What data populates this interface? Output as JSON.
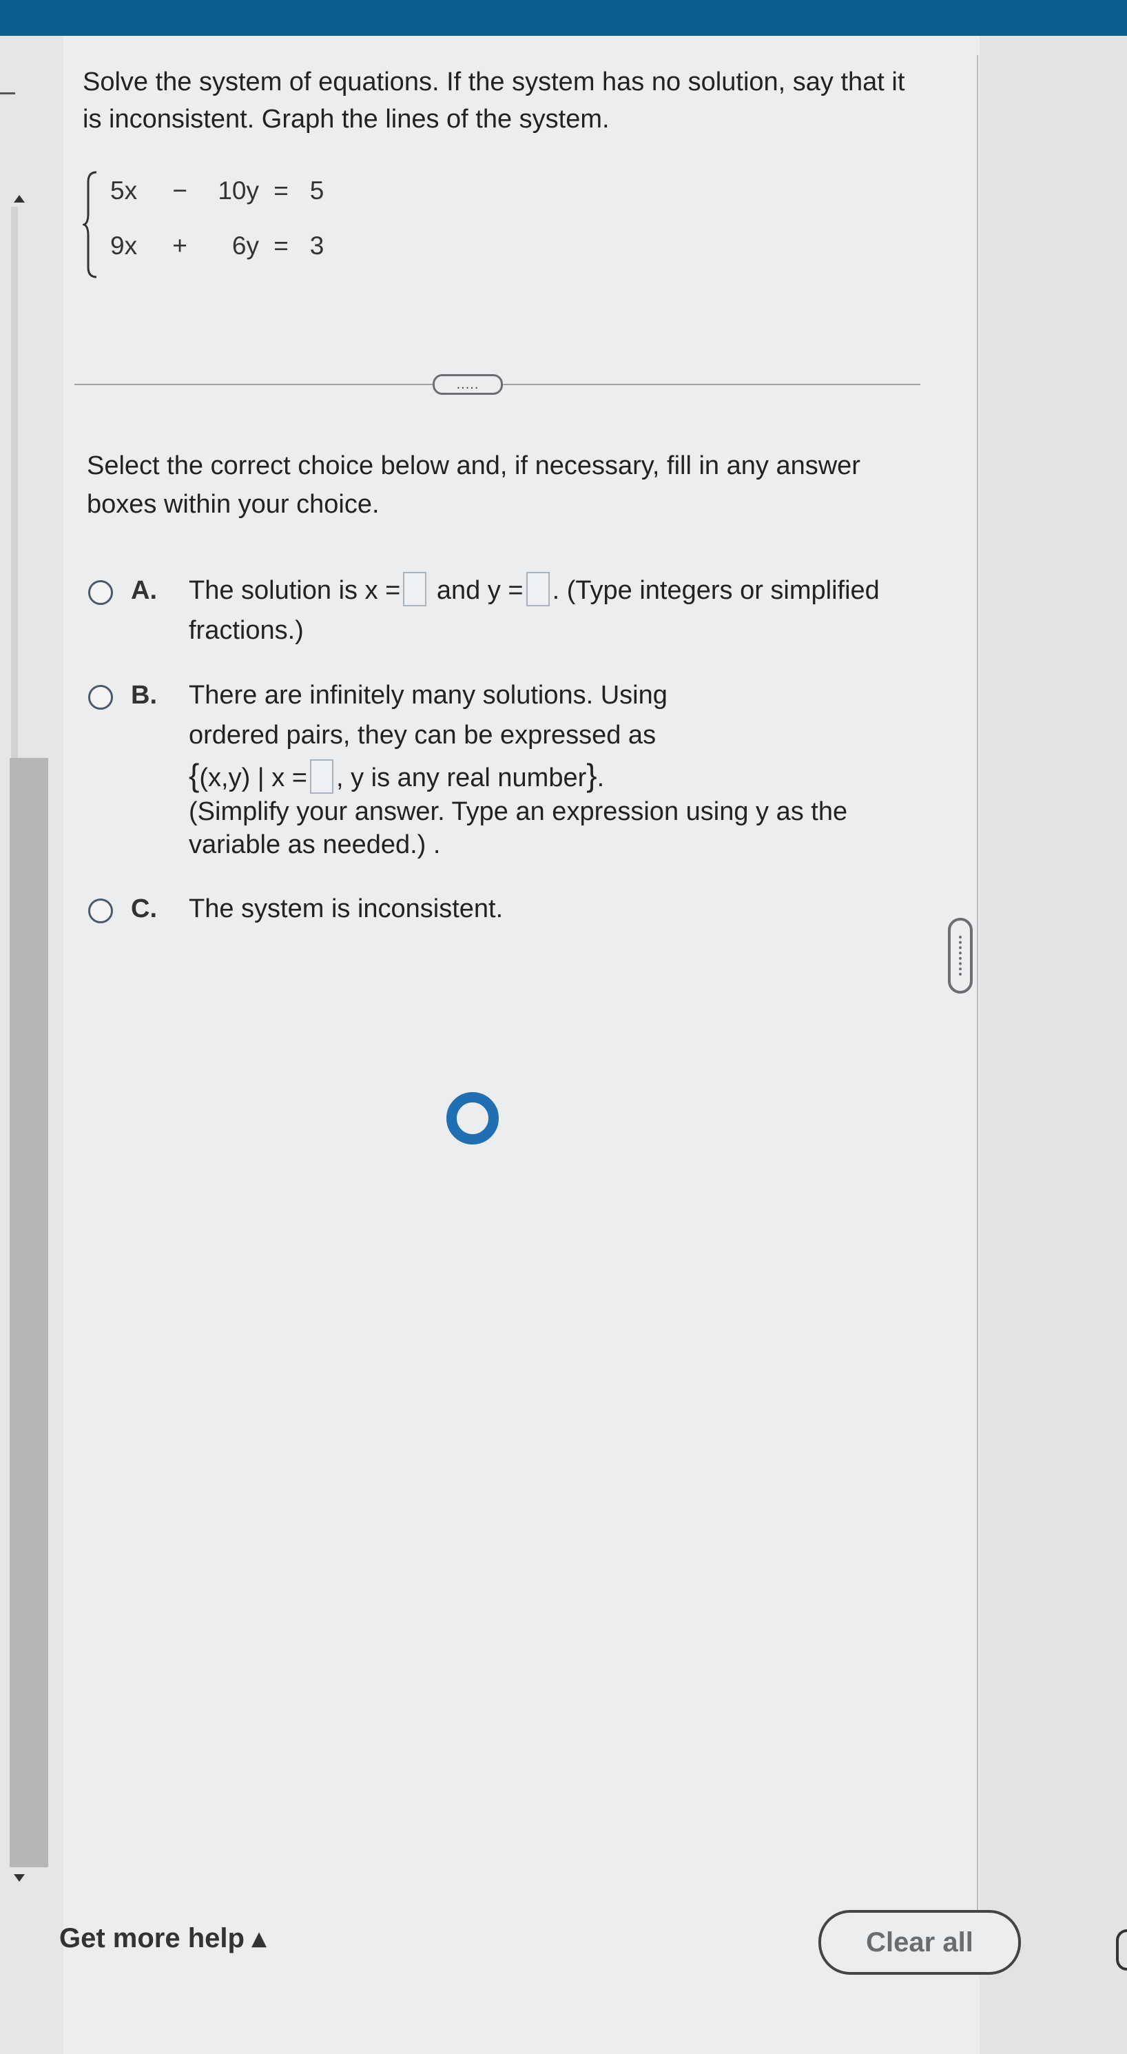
{
  "problem": {
    "instructions": "Solve the system of equations. If the system has no solution, say that it is inconsistent. Graph the lines of the system.",
    "equations": [
      {
        "t1": "5x",
        "op": "−",
        "t2": "10y",
        "eq": "=",
        "rhs": "5"
      },
      {
        "t1": "9x",
        "op": "+",
        "t2": "6y",
        "eq": "=",
        "rhs": "3"
      }
    ]
  },
  "more_button": {
    "label": "....."
  },
  "prompt": "Select the correct choice below and, if necessary, fill in any answer boxes within your choice.",
  "choices": {
    "a": {
      "letter": "A.",
      "text1": "The solution is x =",
      "text2": "and y =",
      "text3": ". (Type integers or simplified fractions.)"
    },
    "b": {
      "letter": "B.",
      "line1": "There are infinitely many solutions. Using ordered pairs, they can be expressed as",
      "set_open": "{",
      "set_left": "(x,y) | x =",
      "set_right": ", y is any real number",
      "set_close": "}",
      "set_end": ".",
      "note": "(Simplify your answer. Type an expression using y as the variable as needed.) ."
    },
    "c": {
      "letter": "C.",
      "text": "The system is inconsistent."
    }
  },
  "footer": {
    "help_label": "Get more help ▴",
    "clear_label": "Clear all"
  }
}
